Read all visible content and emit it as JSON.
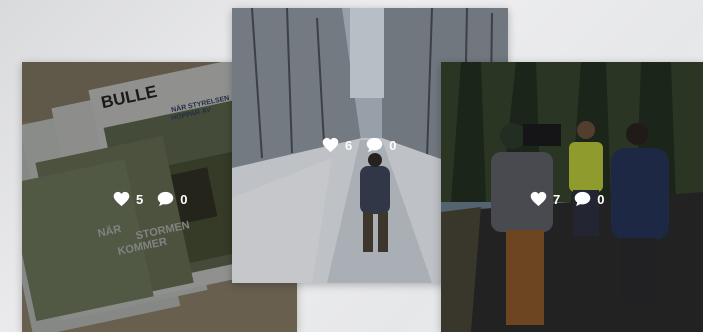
{
  "posts": [
    {
      "id_label": "magazine-post",
      "magazine_masthead": "BULLE",
      "headline_line1": "NÄR STYRELSEN",
      "headline_line2": "HOPPAR AV",
      "cover_text_1": "NÄR",
      "cover_text_2": "STORMEN",
      "cover_text_3": "KOMMER",
      "likes": "5",
      "comments": "0"
    },
    {
      "id_label": "winter-road-post",
      "likes": "6",
      "comments": "0"
    },
    {
      "id_label": "camera-crew-post",
      "likes": "7",
      "comments": "0"
    }
  ],
  "colors": {
    "overlay": "#000000",
    "stat_text": "#ffffff"
  },
  "icons": {
    "like": "heart-icon",
    "comment": "comment-bubble-icon"
  }
}
